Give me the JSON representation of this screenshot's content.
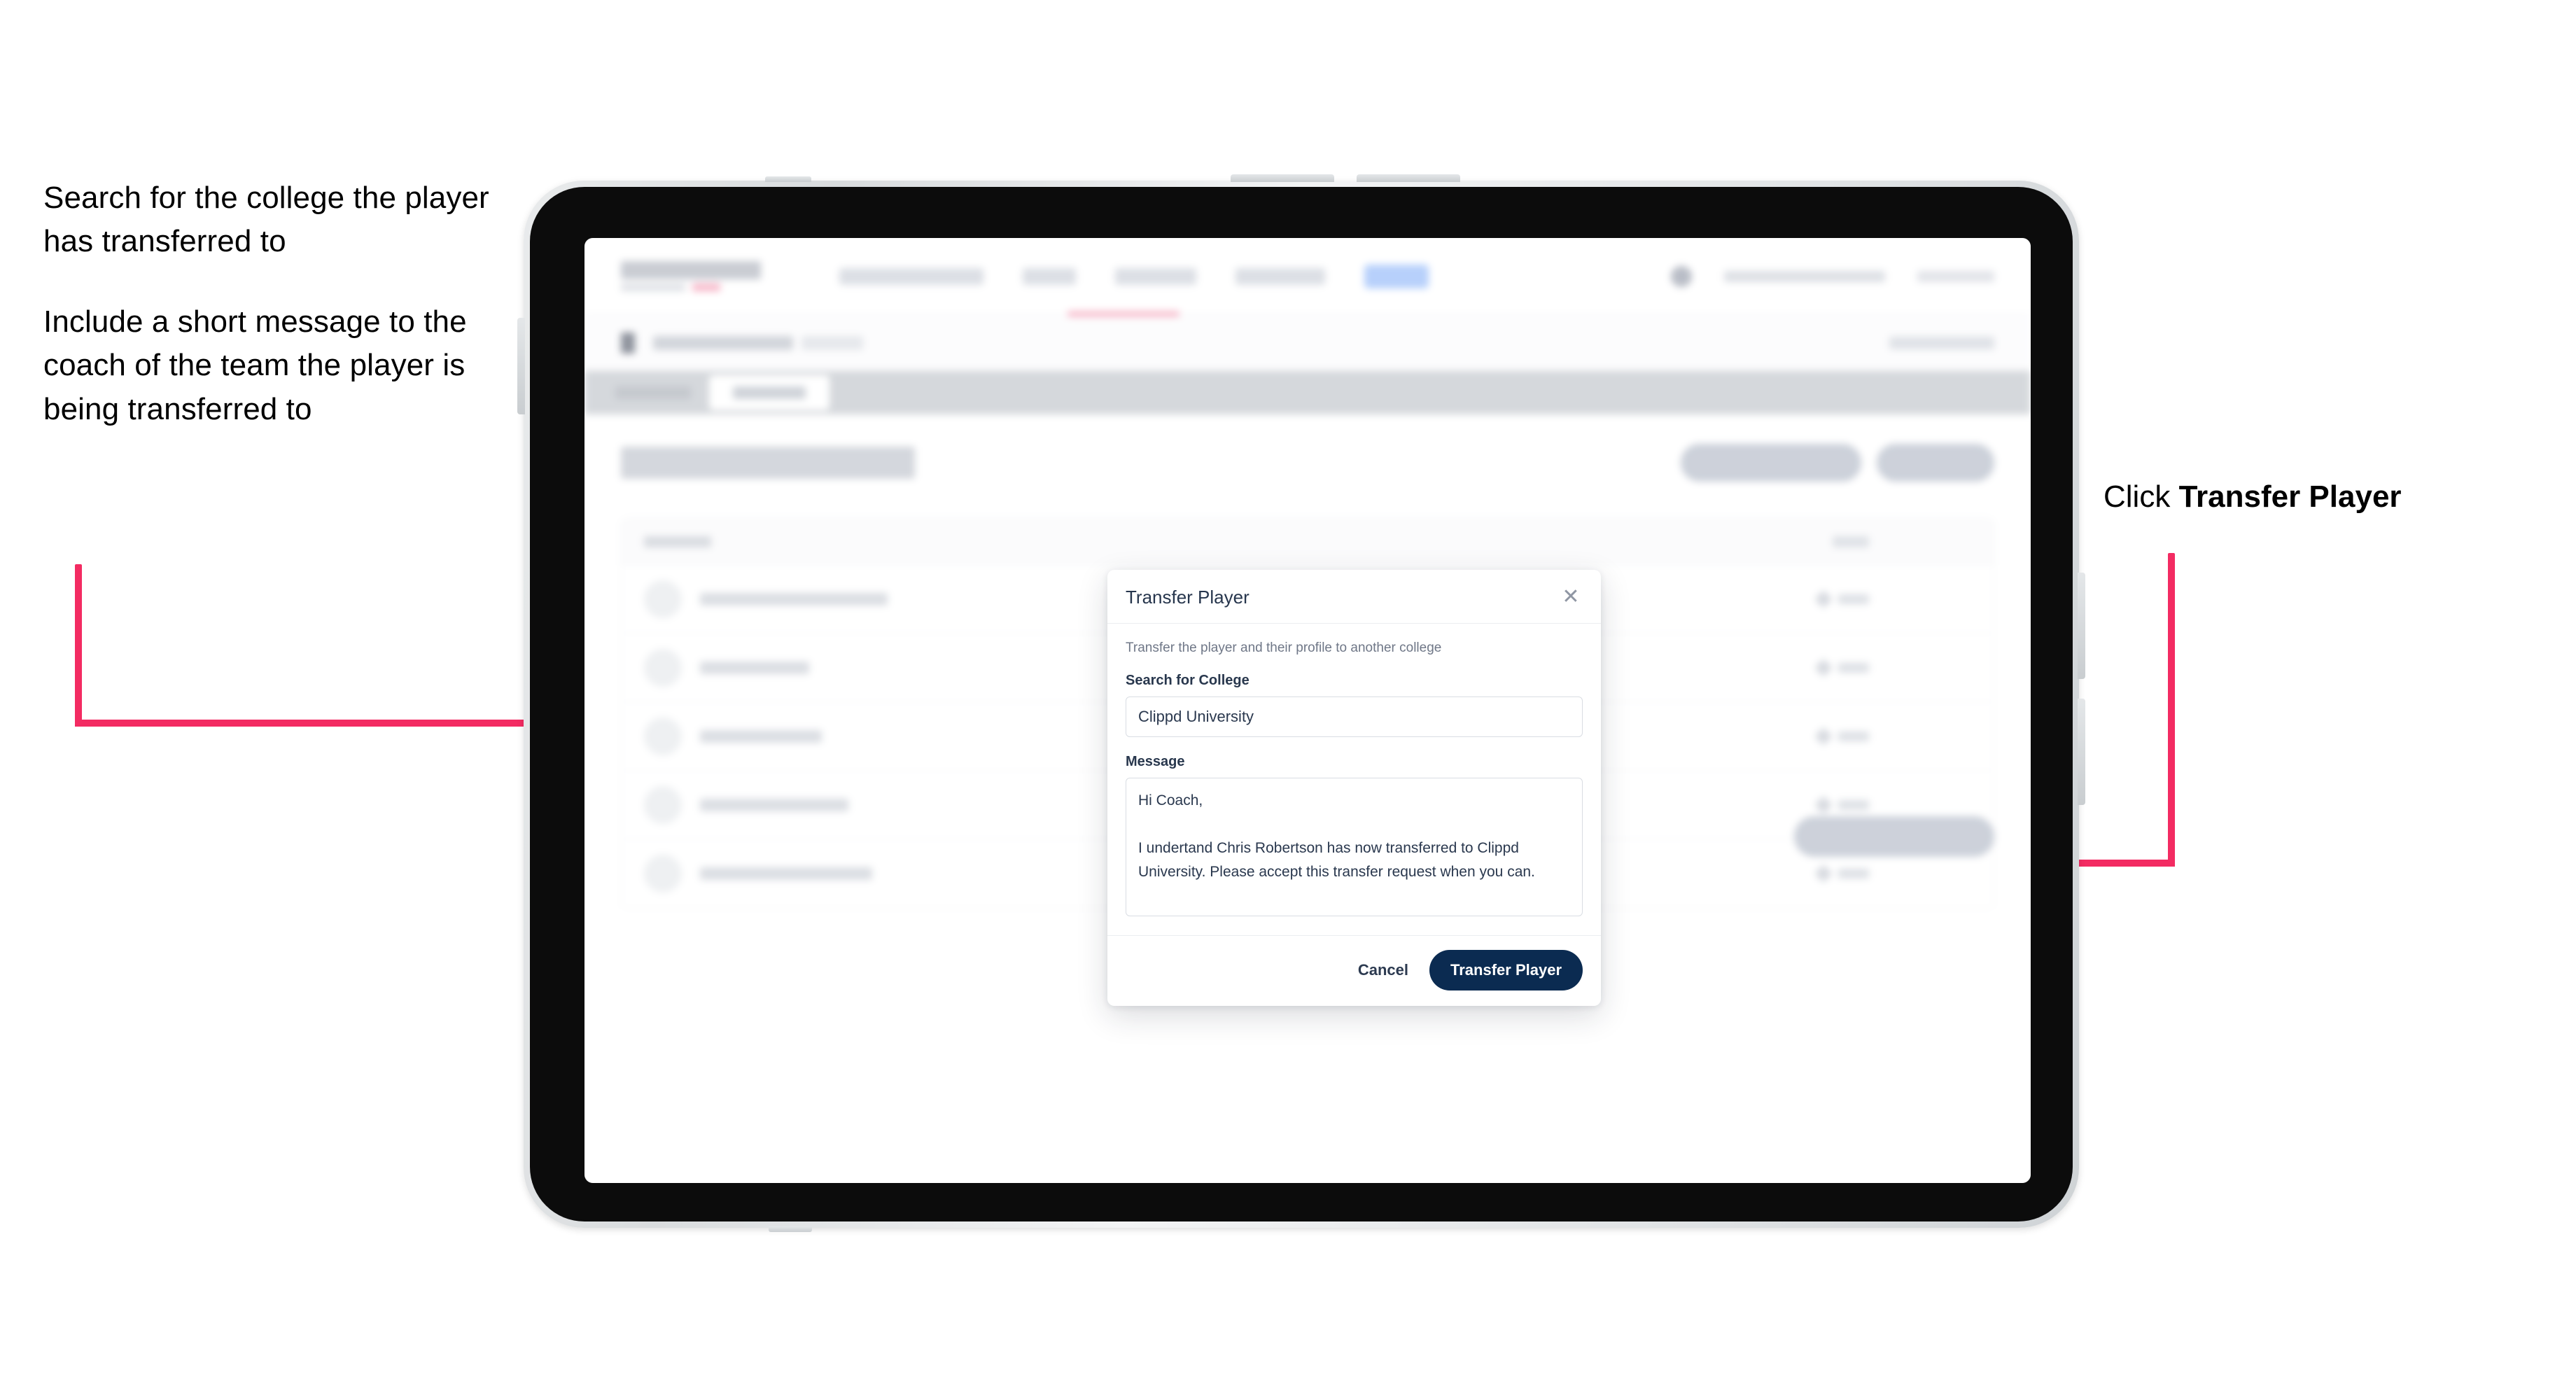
{
  "annotations": {
    "left": [
      "Search for the college the player has transferred to",
      "Include a short message to the coach of the team the player is being transferred to"
    ],
    "right_prefix": "Click ",
    "right_emphasis": "Transfer Player"
  },
  "modal": {
    "title": "Transfer Player",
    "close_icon": "close-icon",
    "description": "Transfer the player and their profile to another college",
    "college_field": {
      "label": "Search for College",
      "value": "Clippd University",
      "placeholder": "Search for College"
    },
    "message_field": {
      "label": "Message",
      "value": "Hi Coach,\n\nI undertand Chris Robertson has now transferred to Clippd University. Please accept this transfer request when you can.",
      "placeholder": "Message"
    },
    "cancel_label": "Cancel",
    "submit_label": "Transfer Player"
  },
  "colors": {
    "accent_pink": "#F32B62",
    "primary_navy": "#0B2B51",
    "modal_title": "#27364D",
    "muted_text": "#6F7787"
  },
  "device": {
    "type": "tablet",
    "hardware_buttons": [
      "power-button",
      "volume-up-button",
      "volume-down-button"
    ]
  }
}
